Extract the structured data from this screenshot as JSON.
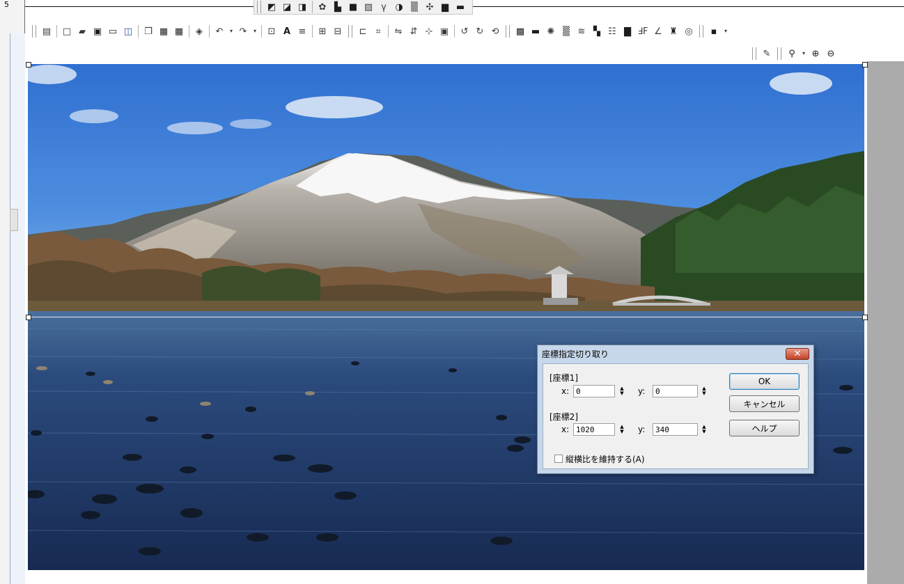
{
  "frame": {
    "left_label": "5"
  },
  "dialog": {
    "title": "座標指定切り取り",
    "close_glyph": "✕",
    "coord1": {
      "label": "[座標1]",
      "x_label": "x:",
      "x_value": "0",
      "y_label": "y:",
      "y_value": "0"
    },
    "coord2": {
      "label": "[座標2]",
      "x_label": "x:",
      "x_value": "1020",
      "y_label": "y:",
      "y_value": "340"
    },
    "ok_label": "OK",
    "cancel_label": "キャンセル",
    "help_label": "ヘルプ",
    "keep_aspect_label": "縦横比を維持する(A)",
    "keep_aspect_checked": false
  },
  "toolbars": {
    "top_icons": [
      "image-icon",
      "image-icon",
      "image-icon",
      "effect-icon",
      "image-icon",
      "image-icon",
      "image-icon",
      "gamma-icon",
      "contrast-icon",
      "noise-icon",
      "filter-icon",
      "hdr-icon",
      "image-icon"
    ],
    "main_icons": [
      "properties-icon",
      "new-file-icon",
      "open-file-icon",
      "save-icon",
      "print-icon",
      "print-preview-icon",
      "copy-icon",
      "paste-icon",
      "paste-new-icon",
      "clear-icon",
      "undo-icon",
      "redo-icon",
      "resize-icon",
      "text-icon",
      "align-icon",
      "grid-icon",
      "tile-icon",
      "trim-icon",
      "auto-trim-icon",
      "flip-horizontal-icon",
      "flip-vertical-icon",
      "center-icon",
      "frame-icon",
      "rotate-90-left-icon",
      "rotate-90-right-icon",
      "rotate-free-icon",
      "color-depth-icon",
      "grayscale-icon",
      "brightness-icon",
      "noise-icon",
      "wave-icon",
      "mosaic-icon",
      "blur-icon",
      "sharpen-icon",
      "crop-icon",
      "line-icon",
      "paint-icon",
      "spiral-icon",
      "more-icon"
    ],
    "zoom_icons": [
      "eyedropper-icon",
      "zoom-dropdown-icon",
      "zoom-in-icon",
      "zoom-out-icon"
    ]
  }
}
